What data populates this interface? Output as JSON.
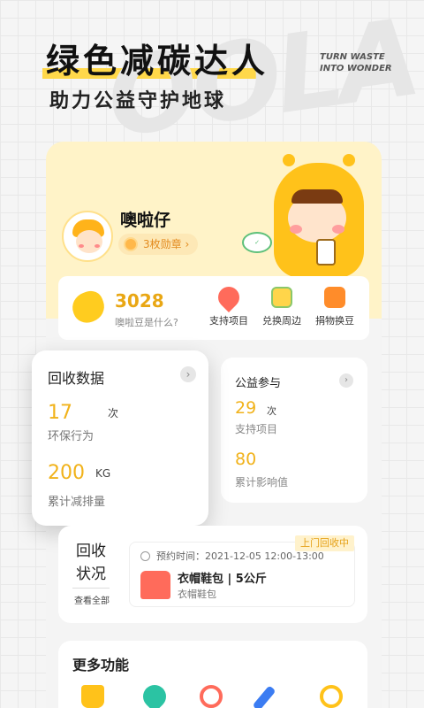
{
  "hero": {
    "title": "绿色减碳达人",
    "subtitle": "助力公益守护地球",
    "watermark": "OOLA",
    "slogan_line1": "TURN WASTE",
    "slogan_line2": "INTO WONDER"
  },
  "profile": {
    "username": "噢啦仔",
    "badge_label": "3枚勋章 ›"
  },
  "beans": {
    "count": "3028",
    "hint": "噢啦豆是什么?",
    "actions": [
      {
        "label": "支持项目",
        "icon": "heart-balloon-icon"
      },
      {
        "label": "兑换周边",
        "icon": "gift-box-icon"
      },
      {
        "label": "捐物换豆",
        "icon": "donation-box-icon"
      }
    ]
  },
  "recycle_data": {
    "title": "回收数据",
    "count_value": "17",
    "count_unit": "次",
    "count_label": "环保行为",
    "emission_value": "200",
    "emission_unit": "KG",
    "emission_label": "累计减排量"
  },
  "public_welfare": {
    "title": "公益参与",
    "projects_value": "29",
    "projects_unit": "次",
    "projects_label": "支持项目",
    "impact_value": "80",
    "impact_label": "累计影响值"
  },
  "recycle_status": {
    "title": "回收状况",
    "view_all": "查看全部",
    "status": "上门回收中",
    "time": "预约时间：2021-12-05  12:00-13:00",
    "item": "衣帽鞋包 | 5公斤",
    "category": "衣帽鞋包"
  },
  "more": {
    "title": "更多功能",
    "icons": [
      "shopping-bag-icon",
      "location-pin-icon",
      "customer-service-icon",
      "pen-icon",
      "ring-icon"
    ]
  },
  "colors": {
    "accent_yellow": "#ffd84a",
    "value_yellow": "#f1b21a",
    "header_bg": "#fff3c8"
  }
}
